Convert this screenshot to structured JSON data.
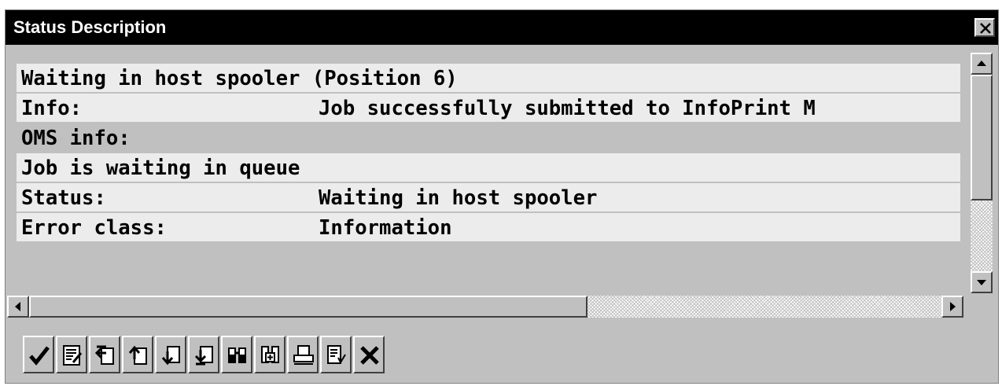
{
  "window": {
    "title": "Status Description"
  },
  "rows": [
    {
      "label": "Waiting in host spooler (Position 6)",
      "value": ""
    },
    {
      "label": "Info:",
      "value": "Job successfully submitted to InfoPrint M"
    },
    {
      "label": "OMS info:",
      "value": ""
    },
    {
      "label": "Job is waiting in queue",
      "value": ""
    },
    {
      "label": "Status:",
      "value": "Waiting in host spooler"
    },
    {
      "label": "Error class:",
      "value": "Information"
    }
  ],
  "toolbar": {
    "buttons": [
      {
        "icon": "checkmark-icon"
      },
      {
        "icon": "detail-list-icon"
      },
      {
        "icon": "first-page-icon"
      },
      {
        "icon": "previous-page-icon"
      },
      {
        "icon": "next-page-icon"
      },
      {
        "icon": "last-page-icon"
      },
      {
        "icon": "find-icon"
      },
      {
        "icon": "find-next-icon"
      },
      {
        "icon": "print-icon"
      },
      {
        "icon": "save-local-file-icon"
      },
      {
        "icon": "cancel-icon"
      }
    ]
  },
  "colors": {
    "titlebar": "#000000",
    "window": "#c0c0c0",
    "row_light": "#ececec",
    "cancel": "#000000"
  }
}
